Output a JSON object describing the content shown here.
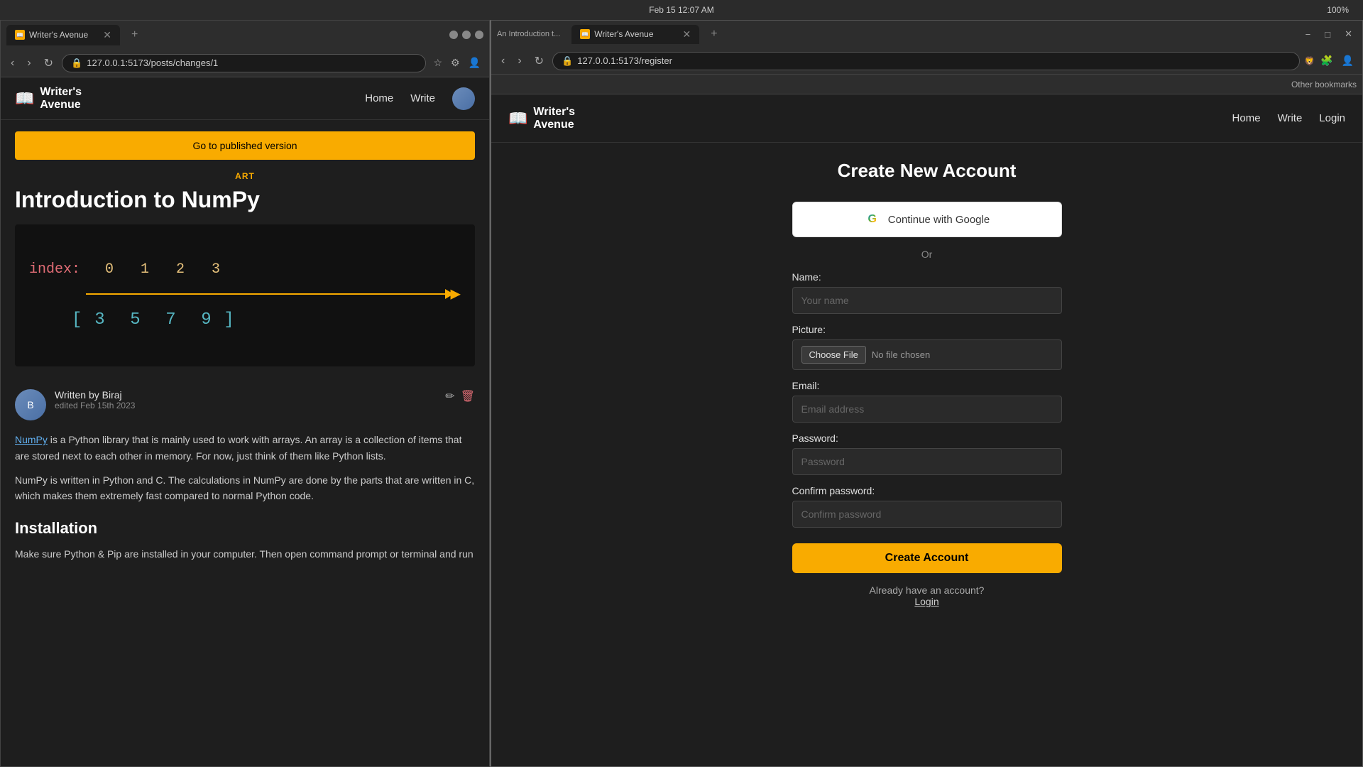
{
  "os": {
    "datetime": "Feb 15  12:07 AM",
    "battery": "100%"
  },
  "browser1": {
    "title": "Writer's Avenue",
    "url": "127.0.0.1:5173/posts/changes/1",
    "tab_label": "Writer's Avenue",
    "nav": {
      "logo_line1": "Writer's",
      "logo_line2": "Avenue",
      "links": [
        "Home",
        "Write"
      ],
      "has_avatar": true
    },
    "banner": "Go to published version",
    "article": {
      "category": "ART",
      "title": "Introduction to NumPy",
      "author": "Written by Biraj",
      "edited": "edited Feb 15th 2023",
      "body_para1_link": "NumPy",
      "body_para1": " is a Python library that is mainly used to work with arrays. An array is a collection of items that are stored next to each other in memory. For now, just think of them like Python lists.",
      "body_para2": "NumPy is written in Python and C. The calculations in NumPy are done by the parts that are written in C, which makes them extremely fast compared to normal Python code.",
      "section_title": "Installation",
      "body_para3": "Make sure Python & Pip are installed in your computer. Then open command prompt or terminal and run"
    }
  },
  "browser2": {
    "title": "Writer's Avenue - Brave",
    "url": "127.0.0.1:5173/register",
    "tab_label": "Writer's Avenue",
    "tab_preview": "An Introduction t...",
    "bookmark": "Other bookmarks",
    "nav": {
      "logo_line1": "Writer's",
      "logo_line2": "Avenue",
      "links": [
        "Home",
        "Write",
        "Login"
      ]
    },
    "register": {
      "title": "Create New Account",
      "google_btn": "Continue with Google",
      "divider": "Or",
      "name_label": "Name:",
      "name_placeholder": "Your name",
      "picture_label": "Picture:",
      "choose_file": "Choose File",
      "no_file": "No file chosen",
      "email_label": "Email:",
      "email_placeholder": "Email address",
      "password_label": "Password:",
      "password_placeholder": "Password",
      "confirm_label": "Confirm password:",
      "confirm_placeholder": "Confirm password",
      "create_btn": "Create Account",
      "login_prompt": "Already have an account?",
      "login_link": "Login"
    }
  }
}
